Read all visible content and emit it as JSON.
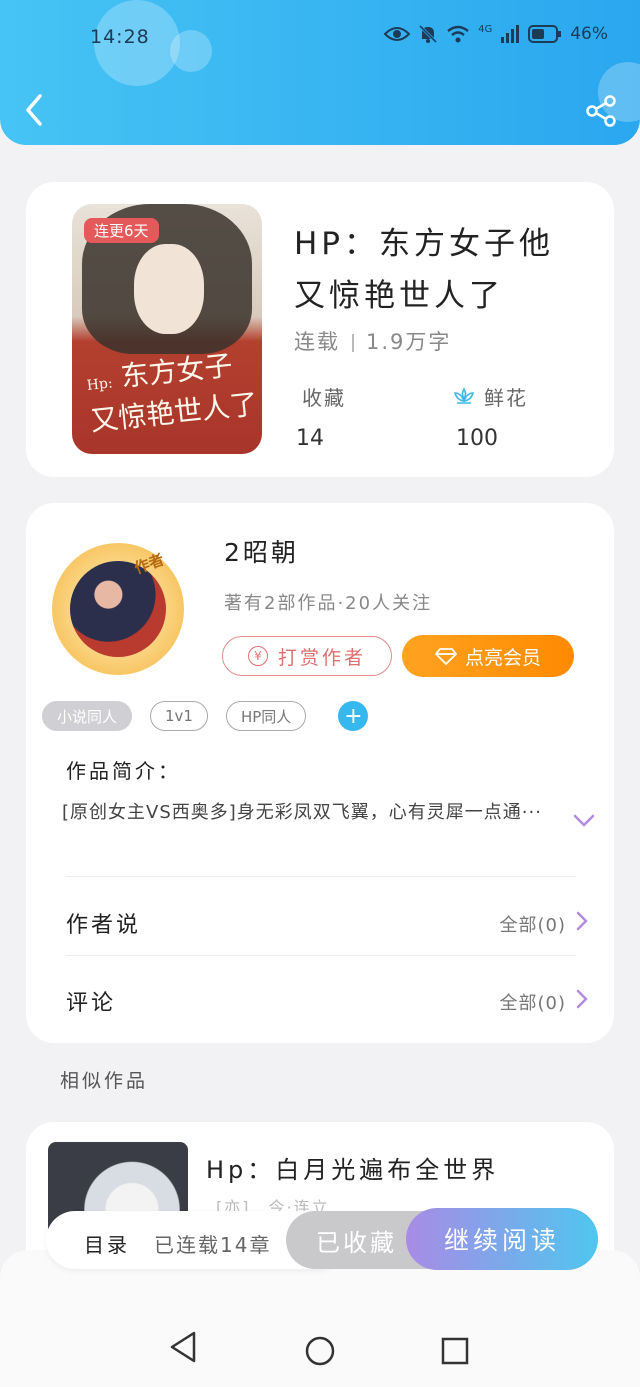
{
  "status_bar": {
    "time": "14:28",
    "network": "4G",
    "battery": "46%"
  },
  "book": {
    "cover_tag": "连更6天",
    "cover_title": "东方女子又惊艳世人了",
    "cover_prefix": "Hp:",
    "title": "HP：东方女子他又惊艳世人了",
    "status": "连载",
    "word_count": "1.9万字",
    "favorites_label": "收藏",
    "favorites_value": "14",
    "flowers_label": "鲜花",
    "flowers_value": "100"
  },
  "author": {
    "badge": "作者",
    "name": "2昭朝",
    "summary": "著有2部作品·20人关注",
    "reward_label": "打赏作者",
    "vip_label": "点亮会员",
    "tags": [
      "小说同人",
      "1v1",
      "HP同人"
    ],
    "intro_title": "作品简介：",
    "intro_text": "[原创女主VS西奥多]身无彩凤双飞翼，心有灵犀一点通···",
    "author_says_label": "作者说",
    "author_says_value": "全部(0)",
    "comments_label": "评论",
    "comments_value": "全部(0)"
  },
  "similar": {
    "section_title": "相似作品",
    "items": [
      {
        "title": "Hp：白月光遍布全世界",
        "sub": "[亦]…今·连立…"
      }
    ]
  },
  "bottom_bar": {
    "catalog": "目录",
    "chapters": "已连载14章",
    "favorited": "已收藏",
    "continue": "继续阅读"
  },
  "colors": {
    "header": "#2aa7ef",
    "accent_orange": "#ff8a00",
    "reward_red": "#e07070"
  }
}
